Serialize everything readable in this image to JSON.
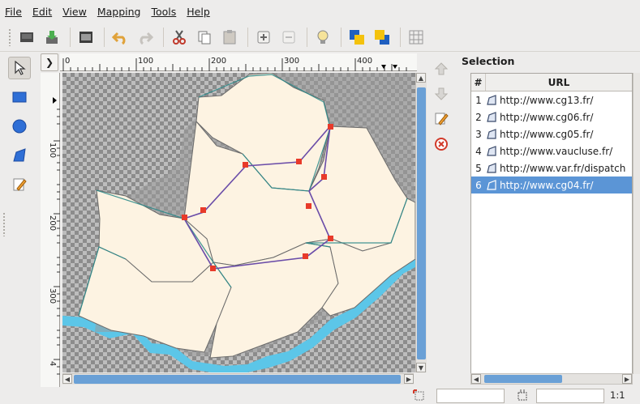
{
  "menubar": {
    "items": [
      {
        "label": "File"
      },
      {
        "label": "Edit"
      },
      {
        "label": "View"
      },
      {
        "label": "Mapping"
      },
      {
        "label": "Tools"
      },
      {
        "label": "Help"
      }
    ]
  },
  "rulers": {
    "horizontal_ticks": [
      "0",
      "100",
      "200",
      "300",
      "400"
    ],
    "vertical_ticks": [
      "100",
      "200",
      "300",
      "4"
    ]
  },
  "selection_panel": {
    "title": "Selection",
    "columns": [
      "#",
      "URL"
    ],
    "rows": [
      {
        "num": "1",
        "url": "http://www.cg13.fr/",
        "selected": false
      },
      {
        "num": "2",
        "url": "http://www.cg06.fr/",
        "selected": false
      },
      {
        "num": "3",
        "url": "http://www.cg05.fr/",
        "selected": false
      },
      {
        "num": "4",
        "url": "http://www.vaucluse.fr/",
        "selected": false
      },
      {
        "num": "5",
        "url": "http://www.var.fr/dispatch",
        "selected": false
      },
      {
        "num": "6",
        "url": "http://www.cg04.fr/",
        "selected": true
      }
    ]
  },
  "statusbar": {
    "zoom": "1:1"
  },
  "colors": {
    "selection": "#5b95d6",
    "scroll_thumb": "#6aa0d6",
    "region_fill": "#fdf3e2",
    "handle": "#e83a2a",
    "path": "#6a4ca8",
    "water": "#5cc6e8"
  }
}
